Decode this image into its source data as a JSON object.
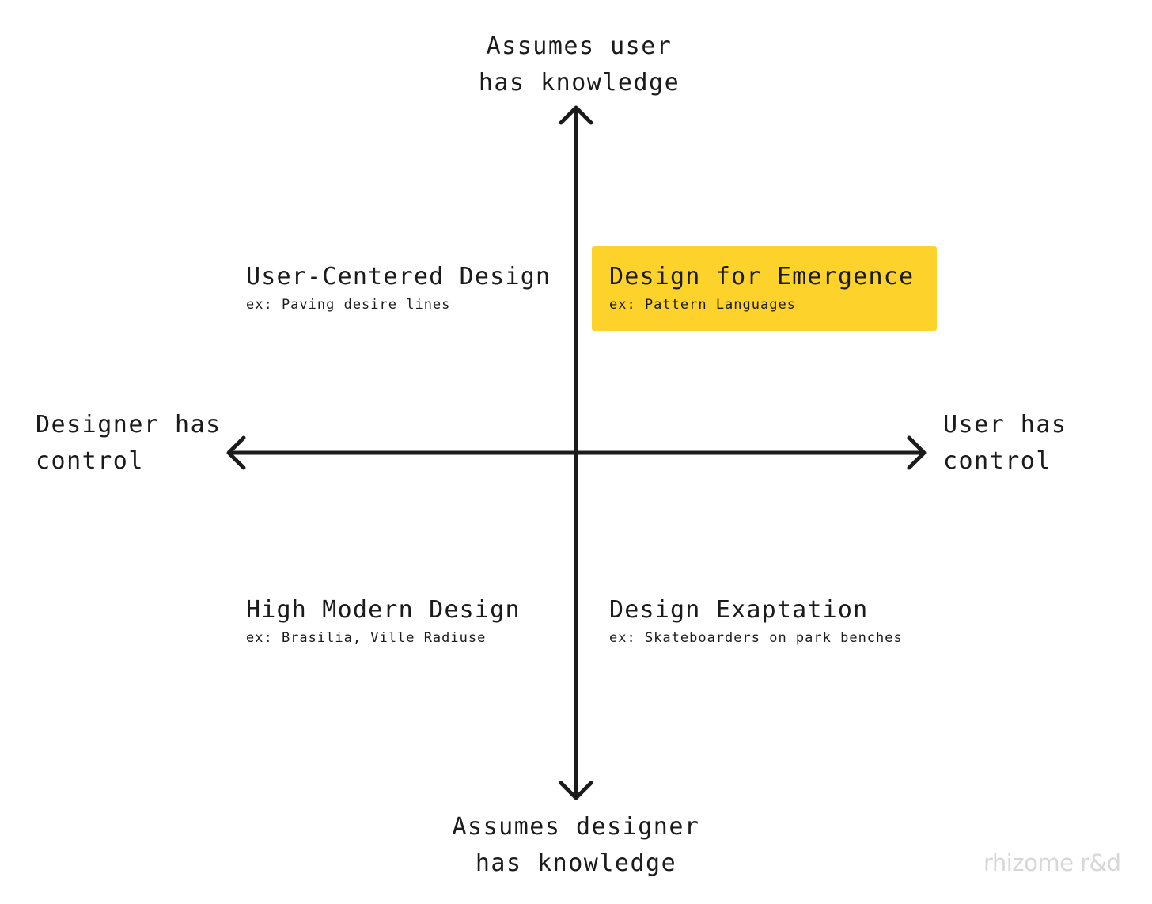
{
  "axes": {
    "top": {
      "line1": "Assumes user",
      "line2": "has knowledge"
    },
    "bottom": {
      "line1": "Assumes designer",
      "line2": "has knowledge"
    },
    "left": {
      "line1": "Designer has",
      "line2": "control"
    },
    "right": {
      "line1": "User has",
      "line2": "control"
    }
  },
  "quadrants": {
    "top_left": {
      "title": "User-Centered Design",
      "example": "ex: Paving desire lines"
    },
    "top_right": {
      "title": "Design for Emergence",
      "example": "ex: Pattern Languages",
      "highlighted": true
    },
    "bottom_left": {
      "title": "High Modern Design",
      "example": "ex: Brasilia, Ville Radiuse"
    },
    "bottom_right": {
      "title": "Design Exaptation",
      "example": "ex: Skateboarders on park benches"
    }
  },
  "watermark": "rhizome r&d",
  "colors": {
    "background": "#ffffff",
    "text": "#1b1b1b",
    "axis": "#1b1b1b",
    "highlight": "#fdd22b",
    "watermark": "#d7d7d7"
  }
}
